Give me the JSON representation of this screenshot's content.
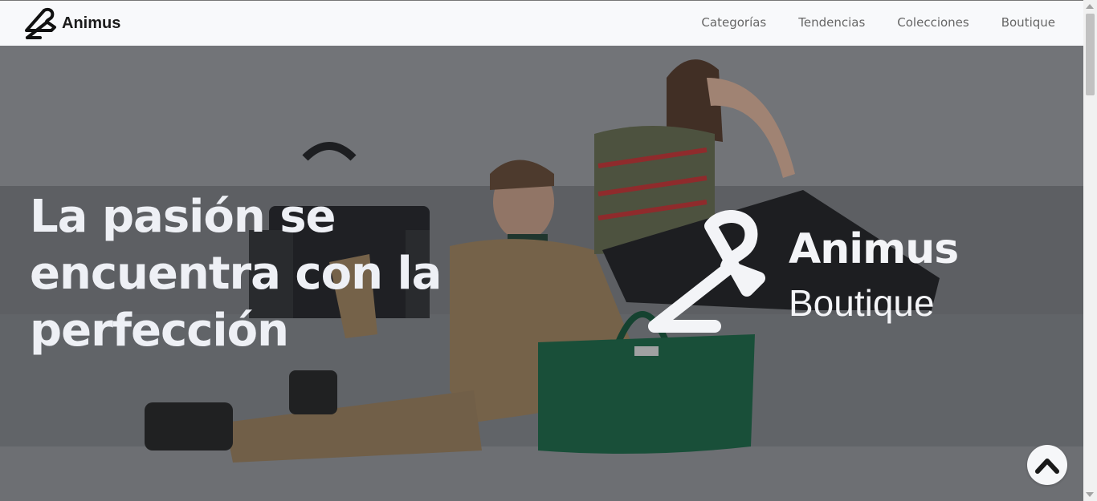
{
  "nav": {
    "brand": "Animus",
    "brand_icon": "hanger-icon",
    "links": [
      "Categorías",
      "Tendencias",
      "Colecciones",
      "Boutique"
    ]
  },
  "hero": {
    "headline_lines": [
      "La pasión se",
      "encuentra con la",
      "perfección"
    ],
    "logo_name": "Animus",
    "logo_sub": "Boutique",
    "logo_icon": "hanger-icon"
  },
  "controls": {
    "back_to_top_icon": "chevron-up-icon"
  },
  "colors": {
    "navbar_bg": "#f8f9fb",
    "hero_text": "#eef0f5",
    "nav_text": "#666666"
  }
}
